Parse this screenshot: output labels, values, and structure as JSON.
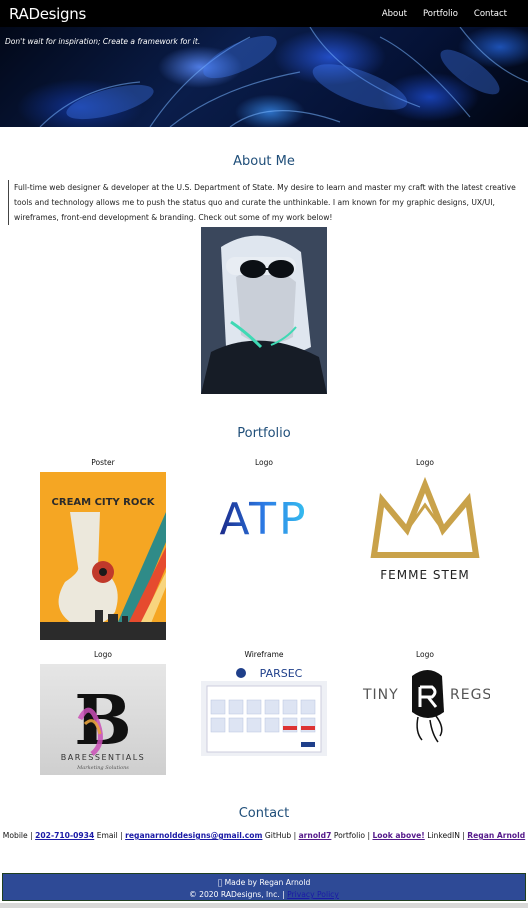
{
  "navbar": {
    "brand": "RADesigns",
    "links": [
      "About",
      "Portfolio",
      "Contact"
    ]
  },
  "hero": {
    "tagline": "Don't wait for inspiration; Create a framework for it."
  },
  "about": {
    "title": "About Me",
    "text": "Full-time web designer & developer at the U.S. Department of State. My desire to learn and master my craft with the latest creative tools and technology allows me to push the status quo and curate the unthinkable. I am known for my graphic designs, UX/UI, wireframes, front-end development & branding. Check out some of my work below!"
  },
  "portfolio": {
    "title": "Portfolio",
    "items": [
      {
        "label": "Poster",
        "art_text": "CREAM CITY ROCK"
      },
      {
        "label": "Logo",
        "art_text": "ATP"
      },
      {
        "label": "Logo",
        "art_text": "FEMME STEM"
      },
      {
        "label": "Logo",
        "art_text": "B",
        "art_sub": "BARESSENTIALS",
        "art_sub2": "Marketing Solutions"
      },
      {
        "label": "Wireframe",
        "art_text": "PARSEC"
      },
      {
        "label": "Logo",
        "art_left": "TINY",
        "art_right": "REGS"
      }
    ]
  },
  "contact": {
    "title": "Contact",
    "mobile_label": "Mobile |",
    "mobile": "202-710-0934",
    "email_label": "Email |",
    "email": "reganarnolddesigns@gmail.com",
    "github_label": "GitHub |",
    "github": "arnold7",
    "portfolio_label": "Portfolio |",
    "portfolio_link": "Look above!",
    "linkedin_label": "LinkedIN |",
    "linkedin": "Regan Arnold"
  },
  "footer": {
    "made_by": "Made by Regan Arnold",
    "copyright": "© 2020 RADesigns, Inc. |",
    "privacy": "Privacy Policy"
  },
  "colors": {
    "accent": "#1f4e79",
    "footer_bg": "#2e4a96",
    "link": "#1a1aa6"
  }
}
